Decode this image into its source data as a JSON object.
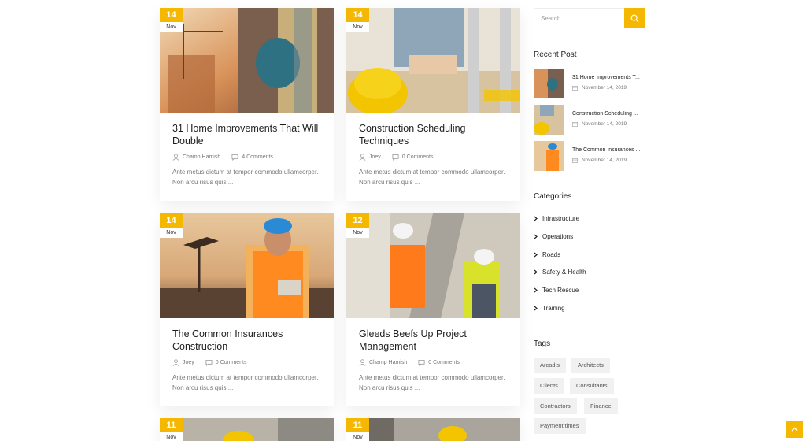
{
  "posts": [
    {
      "day": "14",
      "month": "Nov",
      "title": "31 Home Improvements That Will Double",
      "author": "Champ Hamish",
      "comments": "4 Comments",
      "excerpt": "Ante metus dictum at tempor commodo ullamcorper. Non arcu risus quis ..."
    },
    {
      "day": "14",
      "month": "Nov",
      "title": "Construction Scheduling Techniques",
      "author": "Joey",
      "comments": "0 Comments",
      "excerpt": "Ante metus dictum at tempor commodo ullamcorper. Non arcu risus quis ..."
    },
    {
      "day": "14",
      "month": "Nov",
      "title": "The Common Insurances Construction",
      "author": "Joey",
      "comments": "0 Comments",
      "excerpt": "Ante metus dictum at tempor commodo ullamcorper. Non arcu risus quis ..."
    },
    {
      "day": "12",
      "month": "Nov",
      "title": "Gleeds Beefs Up Project Management",
      "author": "Champ Hamish",
      "comments": "0 Comments",
      "excerpt": "Ante metus dictum at tempor commodo ullamcorper. Non arcu risus quis ..."
    },
    {
      "day": "11",
      "month": "Nov"
    },
    {
      "day": "11",
      "month": "Nov"
    }
  ],
  "sidebar": {
    "search_placeholder": "Search",
    "recent_title": "Recent Post",
    "recent": [
      {
        "title": "31 Home Improvements T...",
        "date": "November 14, 2019"
      },
      {
        "title": "Construction Scheduling ...",
        "date": "November 14, 2019"
      },
      {
        "title": "The Common Insurances ...",
        "date": "November 14, 2019"
      }
    ],
    "categories_title": "Categories",
    "categories": [
      "Infrastructure",
      "Operations",
      "Roads",
      "Safety & Health",
      "Tech Rescue",
      "Training"
    ],
    "tags_title": "Tags",
    "tags": [
      "Arcadis",
      "Architects",
      "Clients",
      "Consultants",
      "Contractors",
      "Finance",
      "Payment times"
    ]
  },
  "colors": {
    "accent": "#f5b800"
  },
  "icons": {
    "search": "search-icon",
    "author": "user-icon",
    "comments": "comment-icon",
    "calendar": "calendar-icon",
    "chevron": "chevron-right-icon",
    "back_to_top": "chevron-up-icon"
  }
}
